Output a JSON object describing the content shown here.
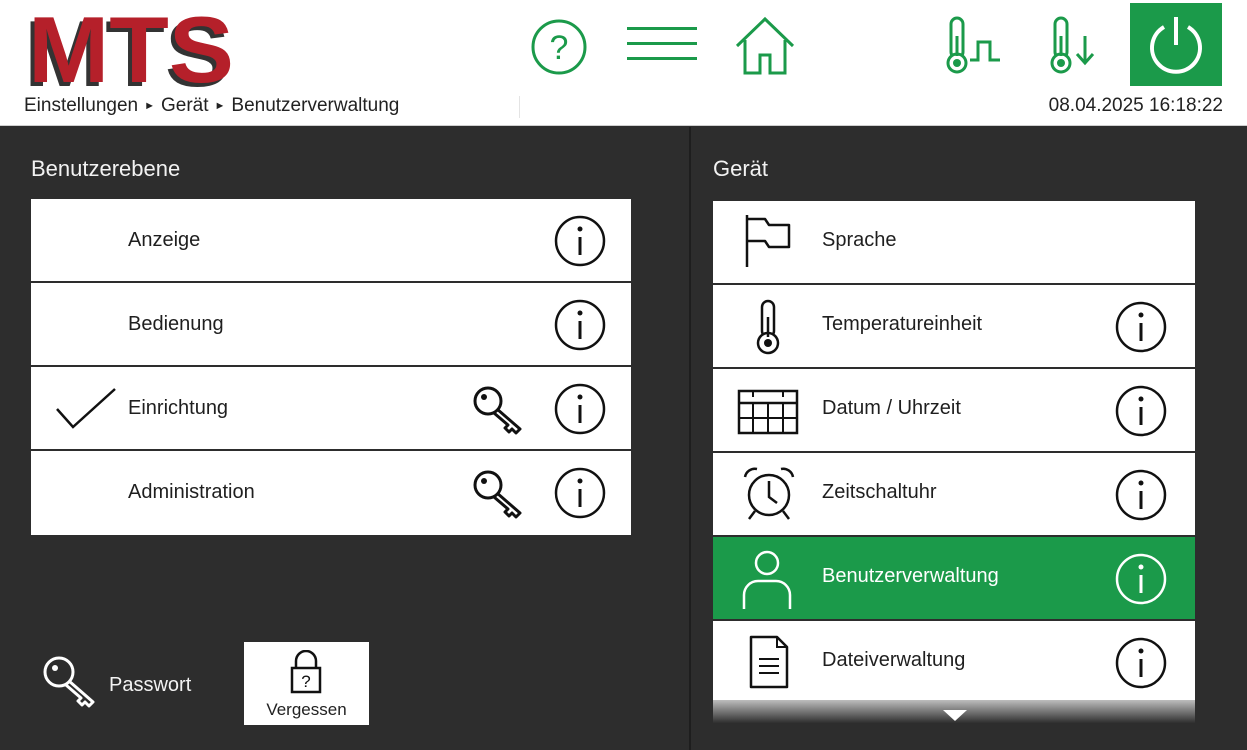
{
  "header": {
    "logo_text": "MTS",
    "breadcrumb": [
      "Einstellungen",
      "Gerät",
      "Benutzerverwaltung"
    ],
    "breadcrumb_sep": "►",
    "datetime": "08.04.2025 16:18:22",
    "icons": [
      "help-icon",
      "menu-icon",
      "home-icon",
      "temperature-program-icon",
      "temperature-down-icon",
      "power-icon"
    ],
    "accent_color": "#1b9a4a"
  },
  "left": {
    "title": "Benutzerebene",
    "items": [
      {
        "label": "Anzeige",
        "checked": false,
        "key": false
      },
      {
        "label": "Bedienung",
        "checked": false,
        "key": false
      },
      {
        "label": "Einrichtung",
        "checked": true,
        "key": true
      },
      {
        "label": "Administration",
        "checked": false,
        "key": true
      }
    ],
    "password_label": "Passwort",
    "forgot_label": "Vergessen"
  },
  "right": {
    "title": "Gerät",
    "items": [
      {
        "label": "Sprache",
        "icon": "flag-icon",
        "info": false,
        "active": false
      },
      {
        "label": "Temperatureinheit",
        "icon": "thermometer-icon",
        "info": true,
        "active": false
      },
      {
        "label": "Datum / Uhrzeit",
        "icon": "calendar-icon",
        "info": true,
        "active": false
      },
      {
        "label": "Zeitschaltuhr",
        "icon": "alarm-clock-icon",
        "info": true,
        "active": false
      },
      {
        "label": "Benutzerverwaltung",
        "icon": "user-icon",
        "info": true,
        "active": true
      },
      {
        "label": "Dateiverwaltung",
        "icon": "document-icon",
        "info": true,
        "active": false
      }
    ]
  }
}
